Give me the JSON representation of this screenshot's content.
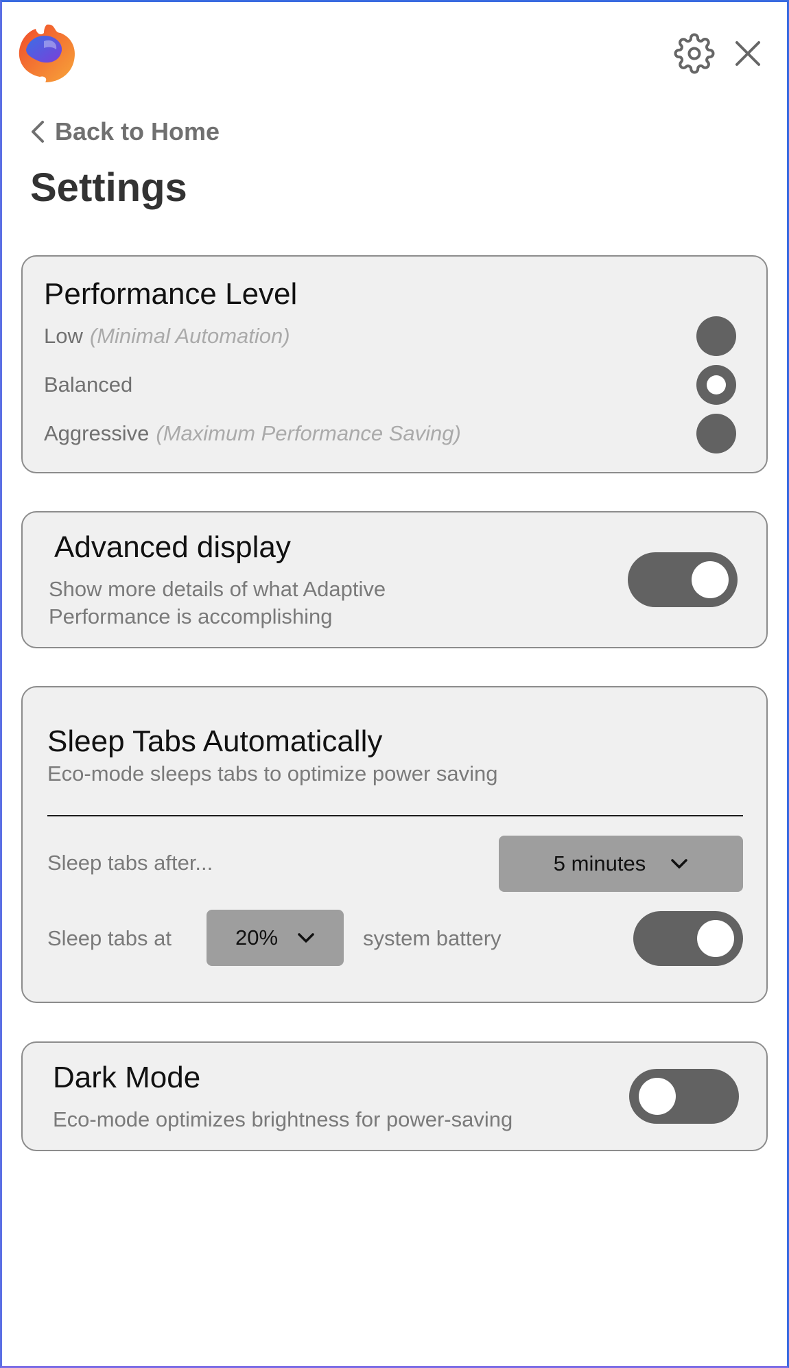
{
  "header": {
    "logo_icon": "browser-flame-logo",
    "settings_icon": "gear-icon",
    "close_icon": "close-icon"
  },
  "nav": {
    "back_label": "Back to Home"
  },
  "page": {
    "title": "Settings"
  },
  "performance": {
    "title": "Performance Level",
    "options": [
      {
        "label": "Low",
        "hint": "(Minimal Automation)",
        "selected": false
      },
      {
        "label": "Balanced",
        "hint": "",
        "selected": true
      },
      {
        "label": "Aggressive",
        "hint": "(Maximum Performance Saving)",
        "selected": false
      }
    ]
  },
  "advanced_display": {
    "title": "Advanced display",
    "description": "Show more details of what Adaptive Performance is accomplishing",
    "enabled": true
  },
  "sleep_tabs": {
    "title": "Sleep Tabs Automatically",
    "description": "Eco-mode sleeps tabs to optimize power saving",
    "after_label": "Sleep tabs after...",
    "after_value": "5 minutes",
    "at_label": "Sleep tabs at",
    "battery_value": "20%",
    "battery_suffix": "system battery",
    "battery_enabled": true
  },
  "dark_mode": {
    "title": "Dark Mode",
    "description": "Eco-mode optimizes brightness for power-saving",
    "enabled": false
  },
  "colors": {
    "card_bg": "#f0f0f0",
    "control_dark": "#626262",
    "select_bg": "#9e9e9e",
    "window_border": "#3a6be0"
  }
}
